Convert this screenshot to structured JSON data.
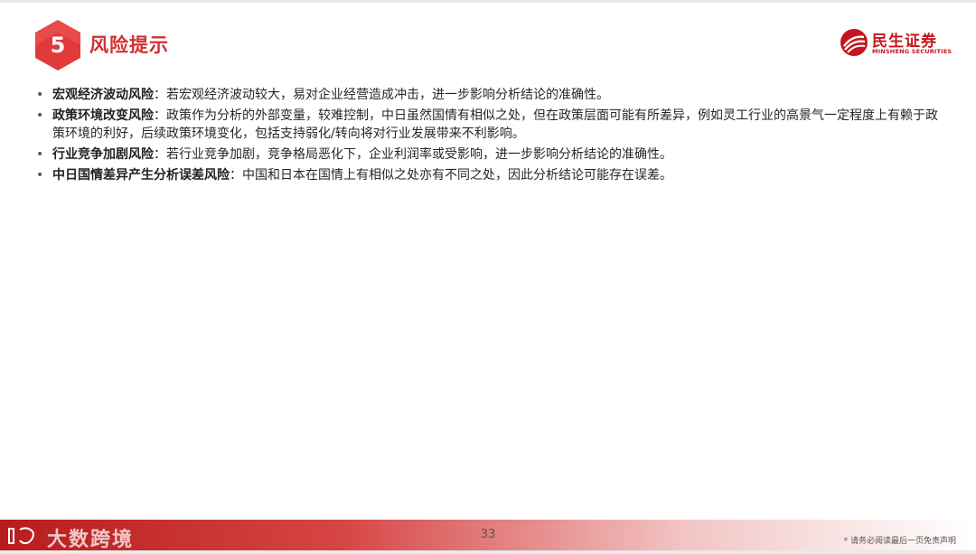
{
  "header": {
    "section_number": "5",
    "title": "风险提示",
    "accent_color": "#d32f2f"
  },
  "brand": {
    "name": "民生证券",
    "subtitle": "MINSHENG SECURITIES",
    "color": "#c4161c",
    "icon": "minsheng-logo-icon"
  },
  "risks": [
    {
      "title": "宏观经济波动风险",
      "text": "：若宏观经济波动较大，易对企业经营造成冲击，进一步影响分析结论的准确性。"
    },
    {
      "title": "政策环境改变风险",
      "text": "：政策作为分析的外部变量，较难控制，中日虽然国情有相似之处，但在政策层面可能有所差异，例如灵工行业的高景气一定程度上有赖于政策环境的利好，后续政策环境变化，包括支持弱化/转向将对行业发展带来不利影响。"
    },
    {
      "title": "行业竞争加剧风险",
      "text": "：若行业竞争加剧，竞争格局恶化下，企业利润率或受影响，进一步影响分析结论的准确性。"
    },
    {
      "title": "中日国情差异产生分析误差风险",
      "text": "：中国和日本在国情上有相似之处亦有不同之处，因此分析结论可能存在误差。"
    }
  ],
  "footer": {
    "watermark": "大数跨境",
    "page_number": "33",
    "disclaimer": "* 请务必阅读最后一页免责声明"
  }
}
